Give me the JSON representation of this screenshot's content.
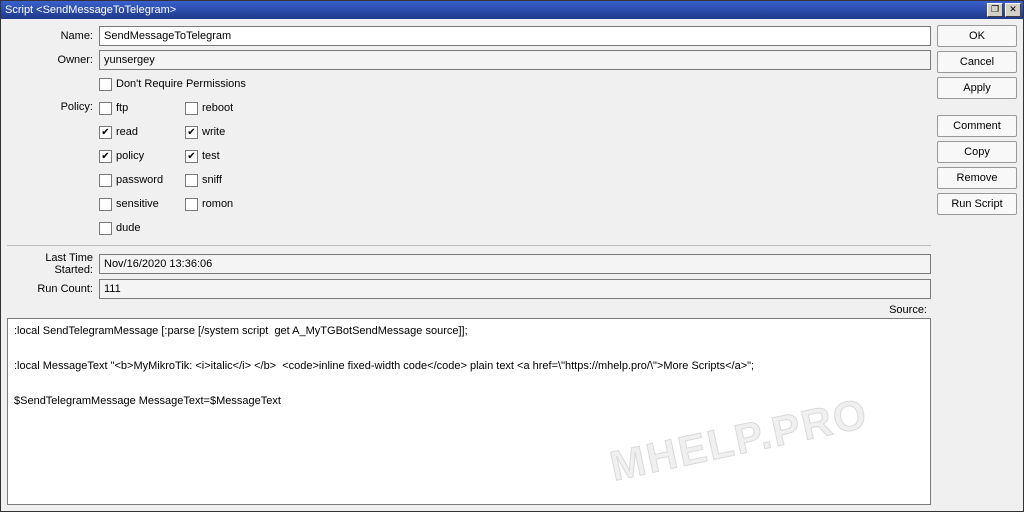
{
  "titlebar": {
    "title": "Script <SendMessageToTelegram>",
    "restore_glyph": "❐",
    "close_glyph": "✕"
  },
  "buttons": {
    "ok": "OK",
    "cancel": "Cancel",
    "apply": "Apply",
    "comment": "Comment",
    "copy": "Copy",
    "remove": "Remove",
    "run_script": "Run Script"
  },
  "labels": {
    "name": "Name:",
    "owner": "Owner:",
    "dont_require": "Don't Require Permissions",
    "policy": "Policy:",
    "last_time": "Last Time Started:",
    "run_count": "Run Count:",
    "source": "Source:"
  },
  "fields": {
    "name": "SendMessageToTelegram",
    "owner": "yunsergey",
    "last_time": "Nov/16/2020 13:36:06",
    "run_count": "111"
  },
  "dont_require_checked": false,
  "policy": {
    "ftp": {
      "label": "ftp",
      "checked": false
    },
    "reboot": {
      "label": "reboot",
      "checked": false
    },
    "read": {
      "label": "read",
      "checked": true
    },
    "write": {
      "label": "write",
      "checked": true
    },
    "policy": {
      "label": "policy",
      "checked": true
    },
    "test": {
      "label": "test",
      "checked": true
    },
    "password": {
      "label": "password",
      "checked": false
    },
    "sniff": {
      "label": "sniff",
      "checked": false
    },
    "sensitive": {
      "label": "sensitive",
      "checked": false
    },
    "romon": {
      "label": "romon",
      "checked": false
    },
    "dude": {
      "label": "dude",
      "checked": false
    }
  },
  "check_glyph": "✔",
  "source_text": ":local SendTelegramMessage [:parse [/system script  get A_MyTGBotSendMessage source]];\n\n:local MessageText \"<b>MyMikroTik: <i>italic</i> </b>  <code>inline fixed-width code</code> plain text <a href=\\\"https://mhelp.pro/\\\">More Scripts</a>\";\n\n$SendTelegramMessage MessageText=$MessageText",
  "watermark": "MHELP.PRO"
}
